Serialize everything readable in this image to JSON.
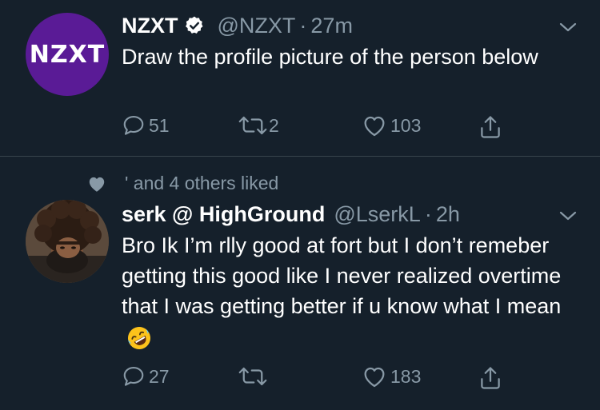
{
  "tweets": [
    {
      "author_name": "NZXT",
      "handle": "@NZXT",
      "separator": "·",
      "time": "27m",
      "verified": true,
      "avatar_text": "NZXT",
      "text": "Draw the profile picture of the person below",
      "replies": "51",
      "retweets": "2",
      "likes": "103"
    },
    {
      "social_context": "' and 4 others liked",
      "author_name": "serk @ HighGround",
      "handle": "@LserkL",
      "separator": "·",
      "time": "2h",
      "text": "Bro Ik I’m rlly good at fort but I don’t remeber getting this good like I never realized overtime that I was getting better if u know what I mean",
      "emoji": "rolling-on-floor-laughing",
      "replies": "27",
      "retweets": "",
      "likes": "183"
    }
  ],
  "colors": {
    "background": "#15202b",
    "text_primary": "#ffffff",
    "text_secondary": "#8899a6",
    "divider": "#38444d",
    "verified": "#ffffff",
    "nzxt_brand": "#5a1b96"
  },
  "icons": [
    "chevron-down-icon",
    "verified-badge-icon",
    "reply-icon",
    "retweet-icon",
    "like-icon",
    "share-icon",
    "heart-liked-icon"
  ]
}
